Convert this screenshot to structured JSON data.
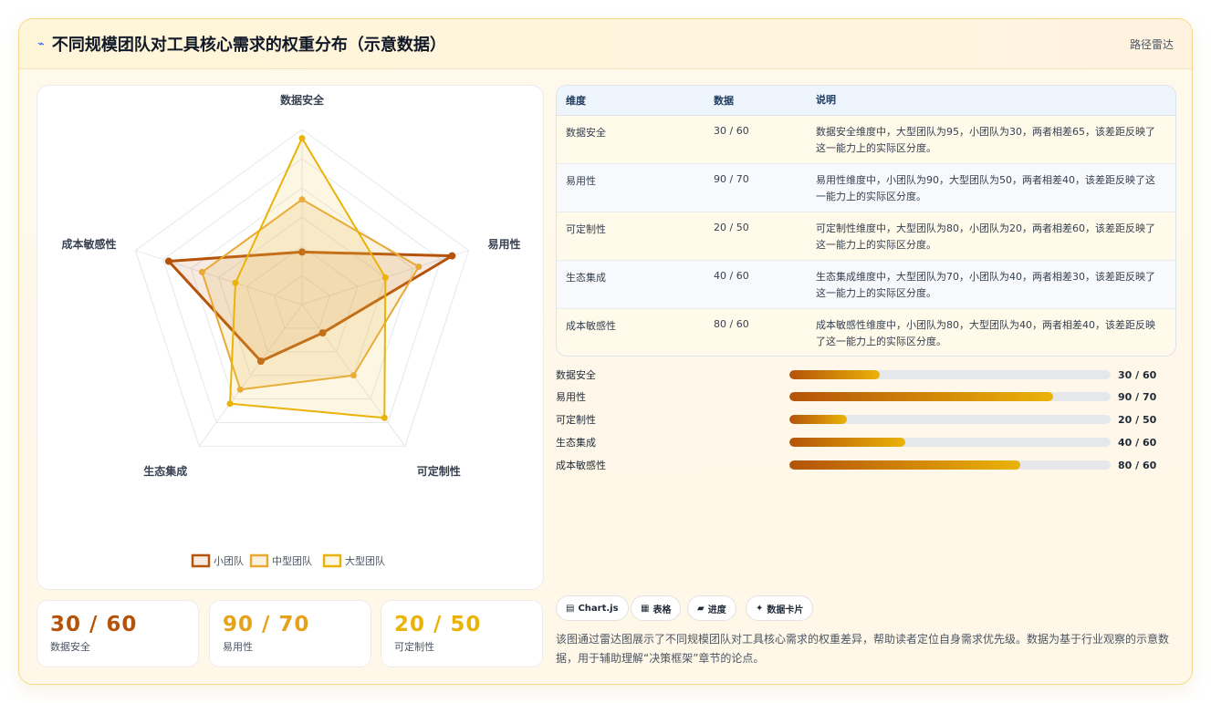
{
  "header": {
    "icon": "⌁",
    "title": "不同规模团队对工具核心需求的权重分布（示意数据）",
    "tag": "路径雷达"
  },
  "colors": {
    "small": "#b45309",
    "medium": "#eab308",
    "large": "#f2c84b"
  },
  "chart_data": {
    "type": "radar",
    "axes": [
      "数据安全",
      "易用性",
      "可定制性",
      "生态集成",
      "成本敏感性"
    ],
    "range": [
      0,
      100
    ],
    "series": [
      {
        "name": "小团队",
        "values": [
          30,
          90,
          20,
          40,
          80
        ]
      },
      {
        "name": "中型团队",
        "values": [
          60,
          70,
          50,
          60,
          60
        ]
      },
      {
        "name": "大型团队",
        "values": [
          95,
          50,
          80,
          70,
          40
        ]
      }
    ],
    "legend": "bottom"
  },
  "kpis": [
    {
      "value": "30 / 60",
      "label": "数据安全",
      "color": "#b45309"
    },
    {
      "value": "90 / 70",
      "label": "易用性",
      "color": "#e5a21a"
    },
    {
      "value": "20 / 50",
      "label": "可定制性",
      "color": "#eab308"
    }
  ],
  "table": {
    "headers": [
      "维度",
      "数据",
      "说明"
    ],
    "rows": [
      {
        "dim": "数据安全",
        "data": "30 / 60",
        "desc": "数据安全维度中，大型团队为95，小团队为30，两者相差65，该差距反映了这一能力上的实际区分度。"
      },
      {
        "dim": "易用性",
        "data": "90 / 70",
        "desc": "易用性维度中，小团队为90，大型团队为50，两者相差40，该差距反映了这一能力上的实际区分度。"
      },
      {
        "dim": "可定制性",
        "data": "20 / 50",
        "desc": "可定制性维度中，大型团队为80，小团队为20，两者相差60，该差距反映了这一能力上的实际区分度。"
      },
      {
        "dim": "生态集成",
        "data": "40 / 60",
        "desc": "生态集成维度中，大型团队为70，小团队为40，两者相差30，该差距反映了这一能力上的实际区分度。"
      },
      {
        "dim": "成本敏感性",
        "data": "80 / 60",
        "desc": "成本敏感性维度中，小团队为80，大型团队为40，两者相差40，该差距反映了这一能力上的实际区分度。"
      }
    ]
  },
  "progress": [
    {
      "label": "数据安全",
      "value": "30 / 60",
      "fill_pct": 28
    },
    {
      "label": "易用性",
      "value": "90 / 70",
      "fill_pct": 82
    },
    {
      "label": "可定制性",
      "value": "20 / 50",
      "fill_pct": 18
    },
    {
      "label": "生态集成",
      "value": "40 / 60",
      "fill_pct": 36
    },
    {
      "label": "成本敏感性",
      "value": "80 / 60",
      "fill_pct": 72
    }
  ],
  "chips": [
    {
      "icon": "▤",
      "label": "Chart.js"
    },
    {
      "icon": "▦",
      "label": "表格"
    },
    {
      "icon": "▰",
      "label": "进度"
    },
    {
      "icon": "✦",
      "label": "数据卡片"
    }
  ],
  "note": "该图通过雷达图展示了不同规模团队对工具核心需求的权重差异，帮助读者定位自身需求优先级。数据为基于行业观察的示意数据，用于辅助理解“决策框架”章节的论点。"
}
